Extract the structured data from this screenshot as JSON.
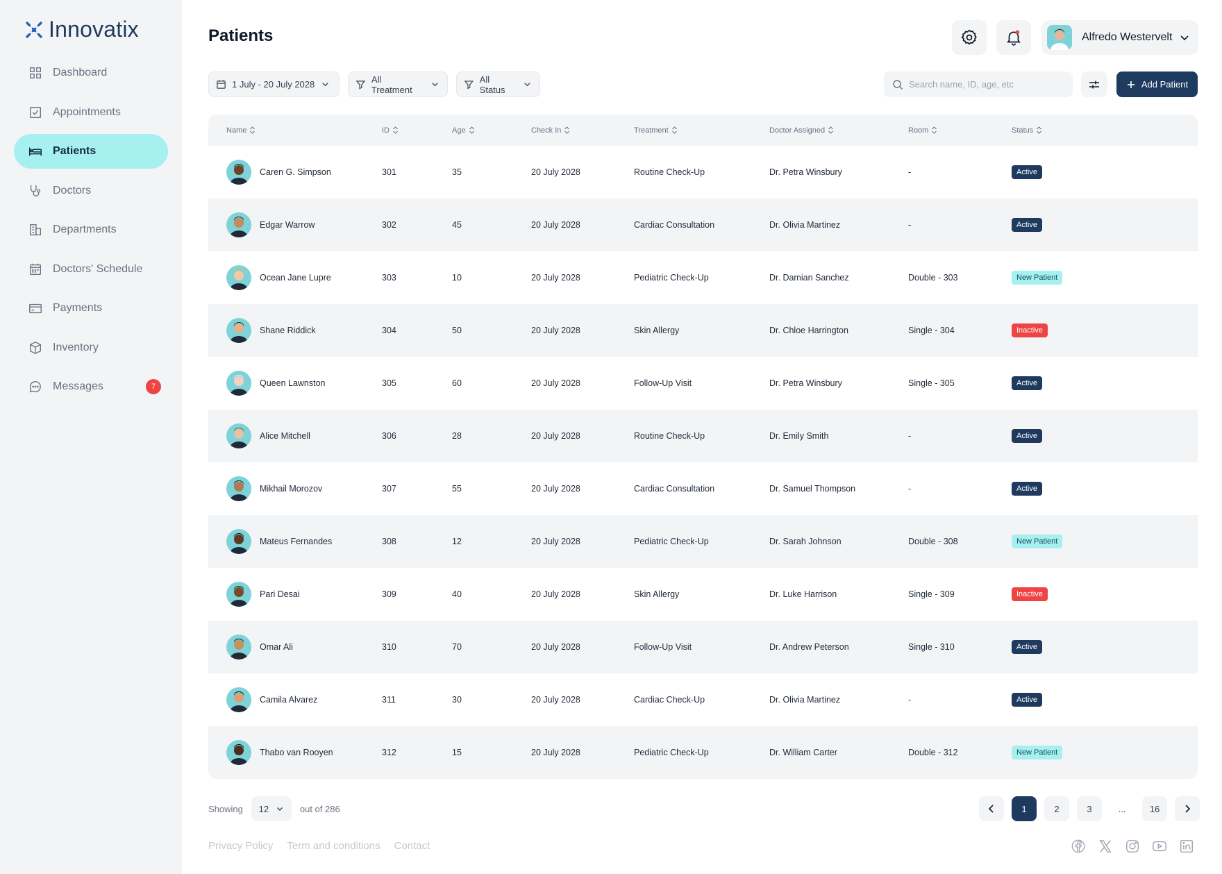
{
  "brand": {
    "name": "Innovatix"
  },
  "nav": [
    {
      "label": "Dashboard",
      "icon": "grid-icon"
    },
    {
      "label": "Appointments",
      "icon": "checkbox-icon"
    },
    {
      "label": "Patients",
      "icon": "bed-icon",
      "active": true
    },
    {
      "label": "Doctors",
      "icon": "stethoscope-icon"
    },
    {
      "label": "Departments",
      "icon": "building-icon"
    },
    {
      "label": "Doctors' Schedule",
      "icon": "calendar-icon"
    },
    {
      "label": "Payments",
      "icon": "card-icon"
    },
    {
      "label": "Inventory",
      "icon": "box-icon"
    },
    {
      "label": "Messages",
      "icon": "chat-icon",
      "badge": "7"
    }
  ],
  "header": {
    "title": "Patients",
    "user_name": "Alfredo Westervelt"
  },
  "filters": {
    "date_range": "1 July - 20 July 2028",
    "treatment": "All Treatment",
    "status": "All Status",
    "search_placeholder": "Search name, ID, age, etc",
    "add_button": "Add Patient"
  },
  "table": {
    "columns": [
      "Name",
      "ID",
      "Age",
      "Check In",
      "Treatment",
      "Doctor Assigned",
      "Room",
      "Status"
    ],
    "rows": [
      {
        "name": "Caren G. Simpson",
        "id": "301",
        "age": "35",
        "check_in": "20 July 2028",
        "treatment": "Routine Check-Up",
        "doctor": "Dr. Petra Winsbury",
        "room": "-",
        "status": "Active"
      },
      {
        "name": "Edgar Warrow",
        "id": "302",
        "age": "45",
        "check_in": "20 July 2028",
        "treatment": "Cardiac Consultation",
        "doctor": "Dr. Olivia Martinez",
        "room": "-",
        "status": "Active"
      },
      {
        "name": "Ocean Jane Lupre",
        "id": "303",
        "age": "10",
        "check_in": "20 July 2028",
        "treatment": "Pediatric Check-Up",
        "doctor": "Dr. Damian Sanchez",
        "room": "Double - 303",
        "status": "New Patient"
      },
      {
        "name": "Shane Riddick",
        "id": "304",
        "age": "50",
        "check_in": "20 July 2028",
        "treatment": "Skin Allergy",
        "doctor": "Dr. Chloe Harrington",
        "room": "Single - 304",
        "status": "Inactive"
      },
      {
        "name": "Queen Lawnston",
        "id": "305",
        "age": "60",
        "check_in": "20 July 2028",
        "treatment": "Follow-Up Visit",
        "doctor": "Dr. Petra Winsbury",
        "room": "Single - 305",
        "status": "Active"
      },
      {
        "name": "Alice Mitchell",
        "id": "306",
        "age": "28",
        "check_in": "20 July 2028",
        "treatment": "Routine Check-Up",
        "doctor": "Dr. Emily Smith",
        "room": "-",
        "status": "Active"
      },
      {
        "name": "Mikhail Morozov",
        "id": "307",
        "age": "55",
        "check_in": "20 July 2028",
        "treatment": "Cardiac Consultation",
        "doctor": "Dr. Samuel Thompson",
        "room": "-",
        "status": "Active"
      },
      {
        "name": "Mateus Fernandes",
        "id": "308",
        "age": "12",
        "check_in": "20 July 2028",
        "treatment": "Pediatric Check-Up",
        "doctor": "Dr. Sarah Johnson",
        "room": "Double - 308",
        "status": "New Patient"
      },
      {
        "name": "Pari Desai",
        "id": "309",
        "age": "40",
        "check_in": "20 July 2028",
        "treatment": "Skin Allergy",
        "doctor": "Dr. Luke Harrison",
        "room": "Single - 309",
        "status": "Inactive"
      },
      {
        "name": "Omar Ali",
        "id": "310",
        "age": "70",
        "check_in": "20 July 2028",
        "treatment": "Follow-Up Visit",
        "doctor": "Dr. Andrew Peterson",
        "room": "Single - 310",
        "status": "Active"
      },
      {
        "name": "Camila Alvarez",
        "id": "311",
        "age": "30",
        "check_in": "20 July 2028",
        "treatment": "Cardiac Check-Up",
        "doctor": "Dr. Olivia Martinez",
        "room": "-",
        "status": "Active"
      },
      {
        "name": "Thabo van Rooyen",
        "id": "312",
        "age": "15",
        "check_in": "20 July 2028",
        "treatment": "Pediatric Check-Up",
        "doctor": "Dr. William Carter",
        "room": "Double - 312",
        "status": "New Patient"
      }
    ]
  },
  "pagination": {
    "showing_label": "Showing",
    "per_page": "12",
    "total_label": "out of 286",
    "pages": [
      "1",
      "2",
      "3",
      "...",
      "16"
    ],
    "current": "1"
  },
  "footer": {
    "links": [
      "Privacy Policy",
      "Term and conditions",
      "Contact"
    ],
    "socials": [
      "facebook-icon",
      "x-icon",
      "instagram-icon",
      "youtube-icon",
      "linkedin-icon"
    ]
  },
  "colors": {
    "primary": "#1e3a5f",
    "accent": "#a7f0f0",
    "danger": "#ef4444",
    "surface": "#f3f4f6"
  }
}
